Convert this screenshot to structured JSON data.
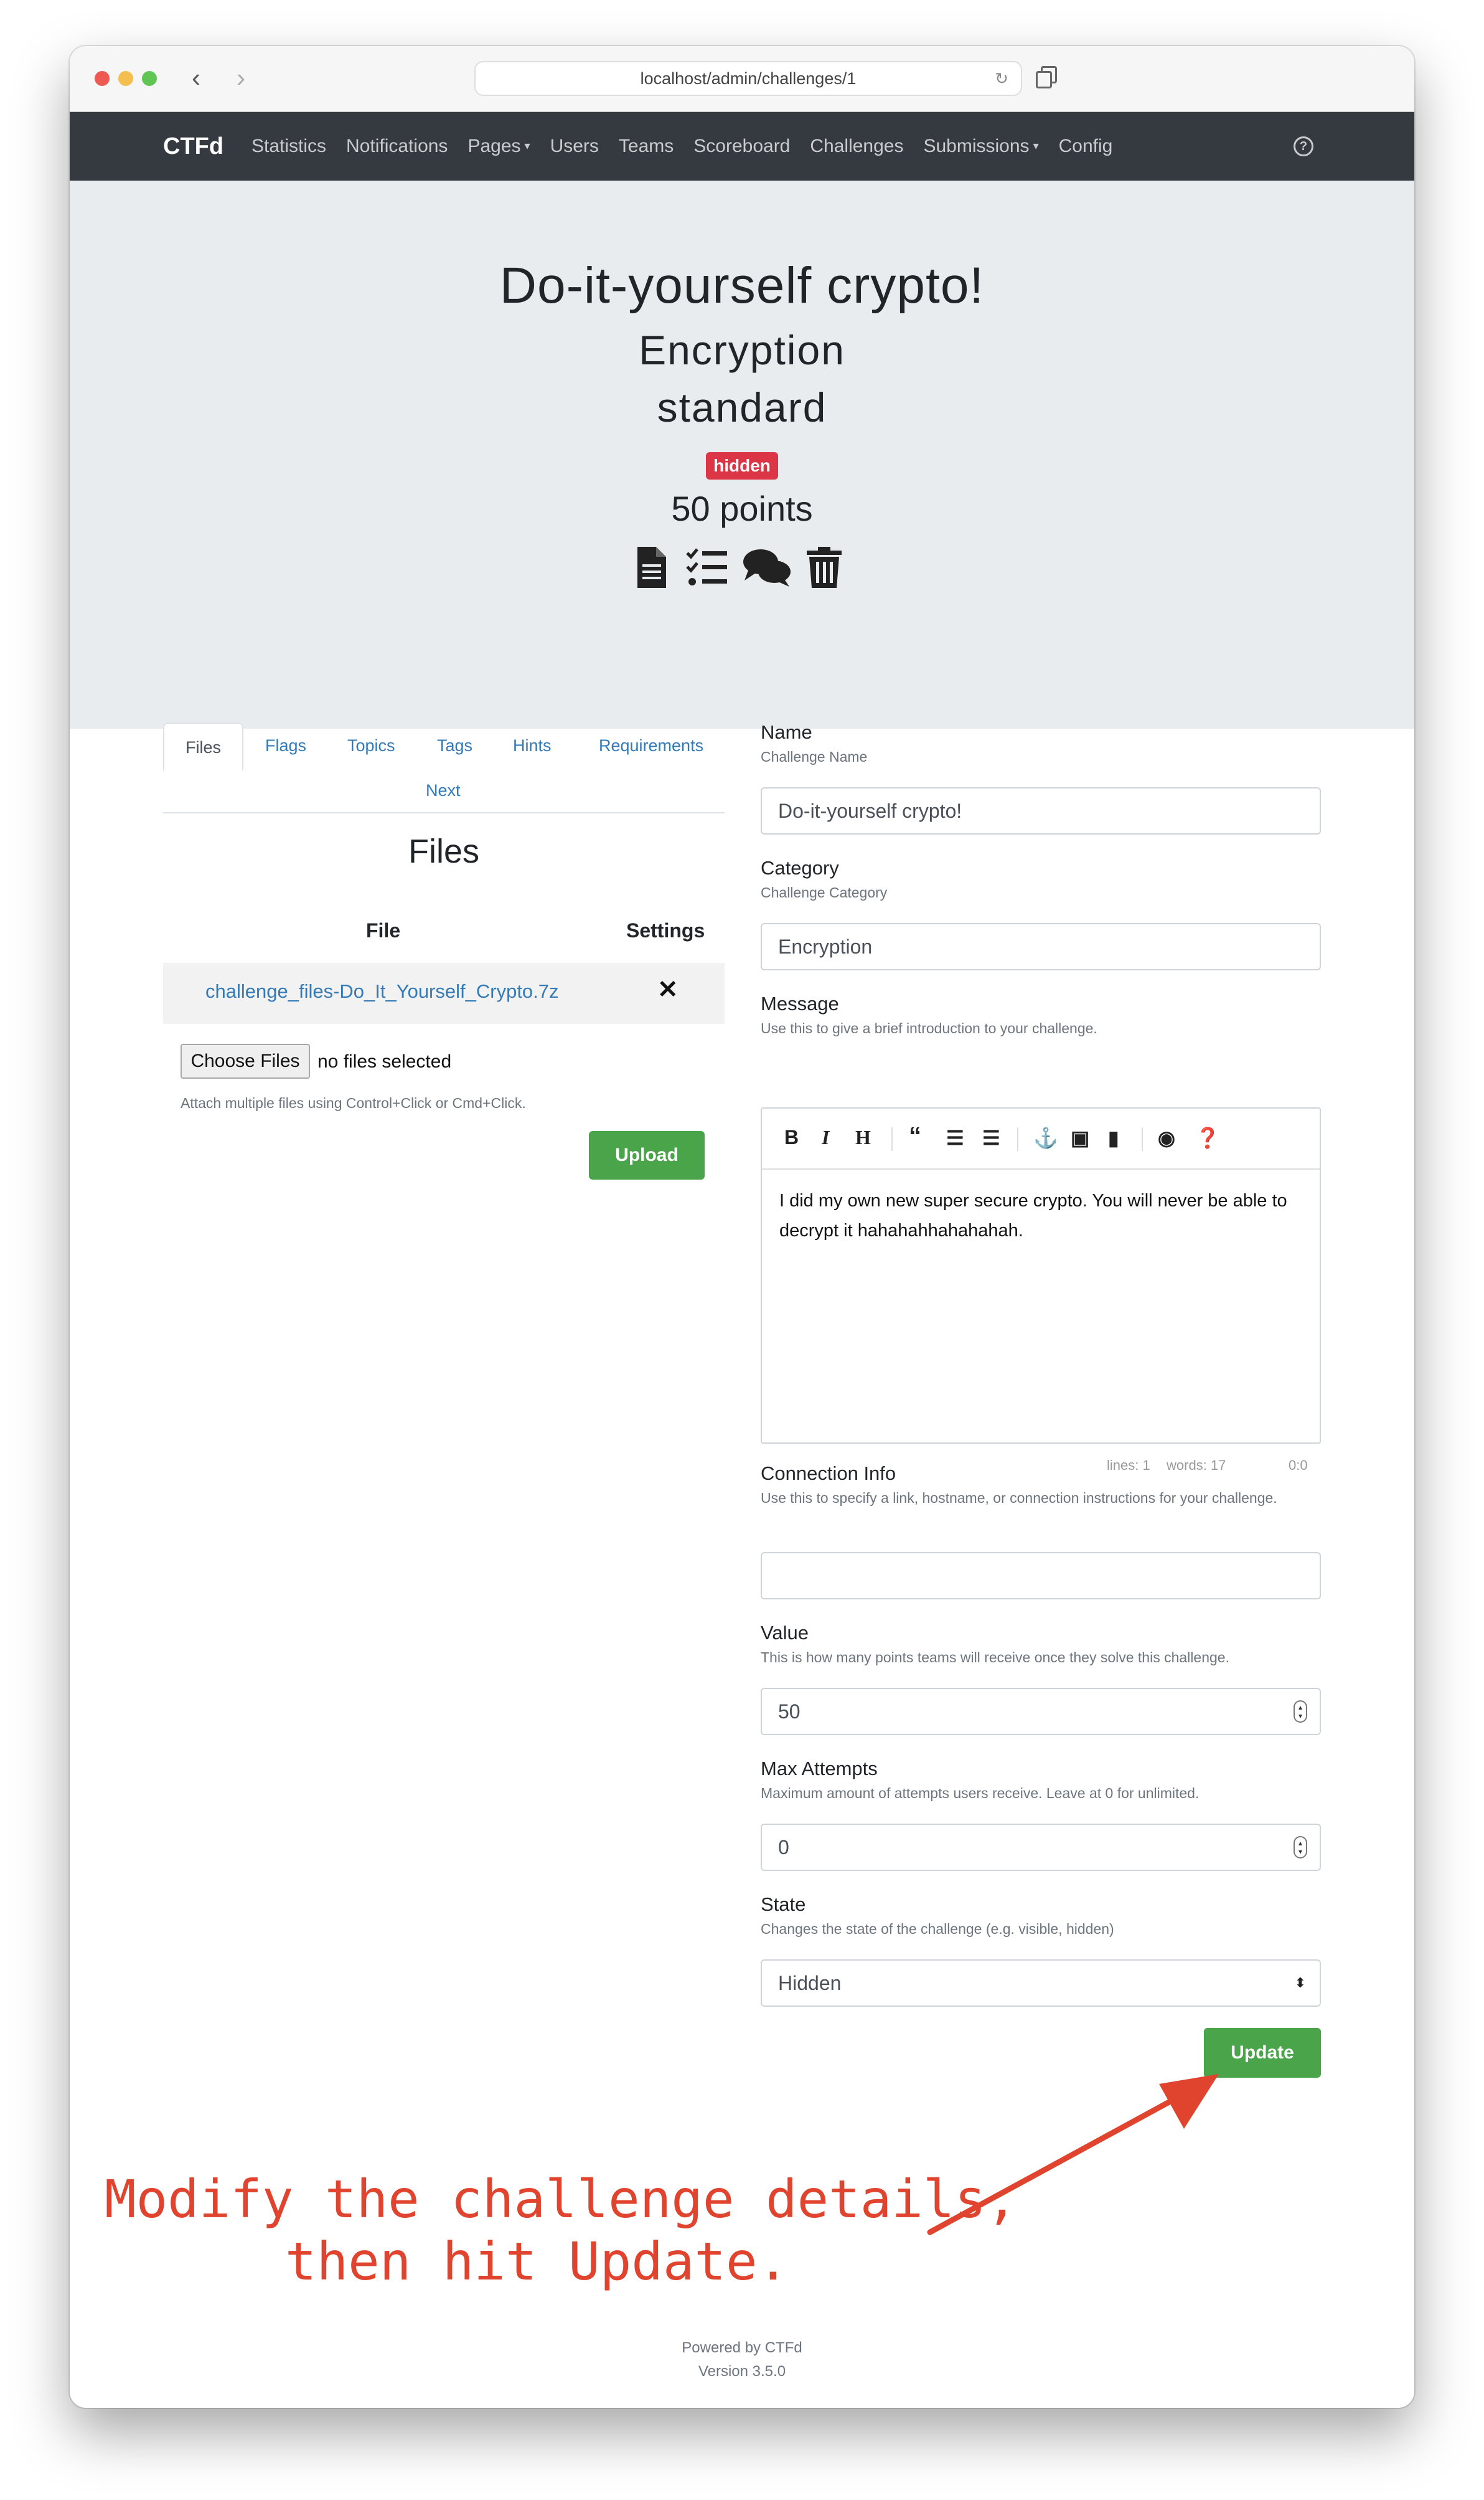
{
  "browser": {
    "url": "localhost/admin/challenges/1"
  },
  "navbar": {
    "brand": "CTFd",
    "links": [
      {
        "label": "Statistics"
      },
      {
        "label": "Notifications"
      },
      {
        "label": "Pages",
        "dropdown": true
      },
      {
        "label": "Users"
      },
      {
        "label": "Teams"
      },
      {
        "label": "Scoreboard"
      },
      {
        "label": "Challenges"
      },
      {
        "label": "Submissions",
        "dropdown": true
      },
      {
        "label": "Config"
      }
    ]
  },
  "challenge": {
    "title": "Do-it-yourself crypto!",
    "category_line1": "Encryption",
    "category_line2": "standard",
    "badge": "hidden",
    "points": "50 points"
  },
  "tabs": {
    "files": "Files",
    "flags": "Flags",
    "topics": "Topics",
    "tags": "Tags",
    "hints": "Hints",
    "requirements": "Requirements",
    "next": "Next"
  },
  "files_panel": {
    "title": "Files",
    "col_file": "File",
    "col_settings": "Settings",
    "files": [
      {
        "name": "challenge_files-Do_It_Yourself_Crypto.7z"
      }
    ],
    "choose_label": "Choose Files",
    "no_files": "no files selected",
    "attach_help": "Attach multiple files using Control+Click or Cmd+Click.",
    "upload_label": "Upload"
  },
  "form": {
    "name": {
      "label": "Name",
      "help": "Challenge Name",
      "value": "Do-it-yourself crypto!"
    },
    "category": {
      "label": "Category",
      "help": "Challenge Category",
      "value": "Encryption"
    },
    "message": {
      "label": "Message",
      "help": "Use this to give a brief introduction to your challenge.",
      "value": "I did my own new super secure crypto. You will never be able to decrypt it hahahahhahahahah.",
      "status_lines": "lines: 1",
      "status_words": "words: 17",
      "status_cursor": "0:0"
    },
    "connection": {
      "label": "Connection Info",
      "help": "Use this to specify a link, hostname, or connection instructions for your challenge.",
      "value": ""
    },
    "value": {
      "label": "Value",
      "help": "This is how many points teams will receive once they solve this challenge.",
      "value": "50"
    },
    "max_attempts": {
      "label": "Max Attempts",
      "help": "Maximum amount of attempts users receive. Leave at 0 for unlimited.",
      "value": "0"
    },
    "state": {
      "label": "State",
      "help": "Changes the state of the challenge (e.g. visible, hidden)",
      "value": "Hidden"
    },
    "update_label": "Update"
  },
  "annotation": {
    "line1": "Modify the challenge details,",
    "line2": "then hit Update.",
    "color": "#e0442e"
  },
  "footer": {
    "powered": "Powered by CTFd",
    "version": "Version 3.5.0"
  },
  "colors": {
    "navbar": "#343a40",
    "jumbotron": "#e9ecef",
    "success": "#4aa44a",
    "danger": "#dc3545",
    "link": "#337ab7"
  }
}
